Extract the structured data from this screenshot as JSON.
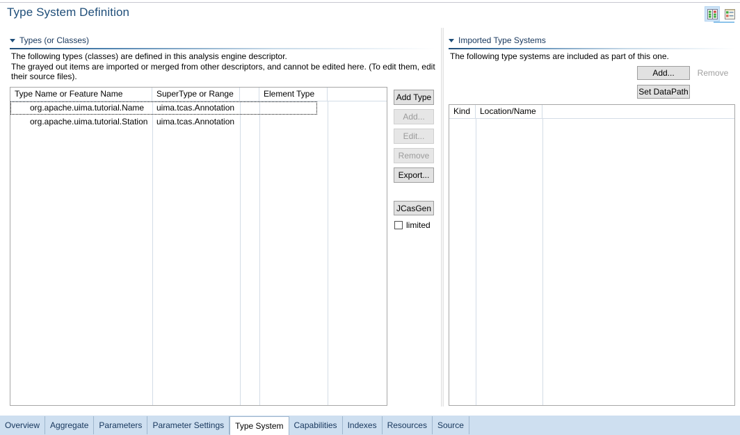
{
  "header": {
    "title": "Type System Definition",
    "toolbar_icons": [
      {
        "name": "two-column-layout-icon",
        "selected": true
      },
      {
        "name": "single-column-layout-icon",
        "selected": false
      }
    ]
  },
  "left_panel": {
    "section_title": "Types (or Classes)",
    "description_lines": [
      "The following types (classes) are defined in this analysis engine descriptor.",
      "The grayed out items are imported or merged from other descriptors, and cannot be edited here. (To edit them, edit",
      "their source files)."
    ],
    "table": {
      "columns": [
        "Type Name or Feature Name",
        "SuperType or Range",
        "",
        "Element Type",
        ""
      ],
      "rows": [
        {
          "type_name": "org.apache.uima.tutorial.Name",
          "supertype": "uima.tcas.Annotation",
          "narrow": "",
          "element_type": "",
          "trailing": "",
          "focused": true
        },
        {
          "type_name": "org.apache.uima.tutorial.Station",
          "supertype": "uima.tcas.Annotation",
          "narrow": "",
          "element_type": "",
          "trailing": "",
          "focused": false
        }
      ]
    },
    "buttons": [
      {
        "label": "Add Type",
        "enabled": true
      },
      {
        "label": "Add...",
        "enabled": false
      },
      {
        "label": "Edit...",
        "enabled": false
      },
      {
        "label": "Remove",
        "enabled": false
      },
      {
        "label": "Export...",
        "enabled": true
      },
      {
        "label": "JCasGen",
        "enabled": true
      }
    ],
    "checkbox": {
      "label": "limited",
      "checked": false
    }
  },
  "right_panel": {
    "section_title": "Imported Type Systems",
    "description": "The following type systems are included as part of this one.",
    "buttons": [
      {
        "label": "Add...",
        "enabled": true
      },
      {
        "label": "Remove",
        "enabled": false
      },
      {
        "label": "Set DataPath",
        "enabled": true
      }
    ],
    "table": {
      "columns": [
        "Kind",
        "Location/Name",
        ""
      ],
      "rows": []
    }
  },
  "tabs": [
    {
      "label": "Overview",
      "active": false
    },
    {
      "label": "Aggregate",
      "active": false
    },
    {
      "label": "Parameters",
      "active": false
    },
    {
      "label": "Parameter Settings",
      "active": false
    },
    {
      "label": "Type System",
      "active": true
    },
    {
      "label": "Capabilities",
      "active": false
    },
    {
      "label": "Indexes",
      "active": false
    },
    {
      "label": "Resources",
      "active": false
    },
    {
      "label": "Source",
      "active": false
    }
  ],
  "colors": {
    "title": "#1f4e79",
    "section_title": "#16365c",
    "tabbar_background": "#cedff0",
    "button_face": "#e1e1e1",
    "table_border": "#a6a6a6"
  }
}
